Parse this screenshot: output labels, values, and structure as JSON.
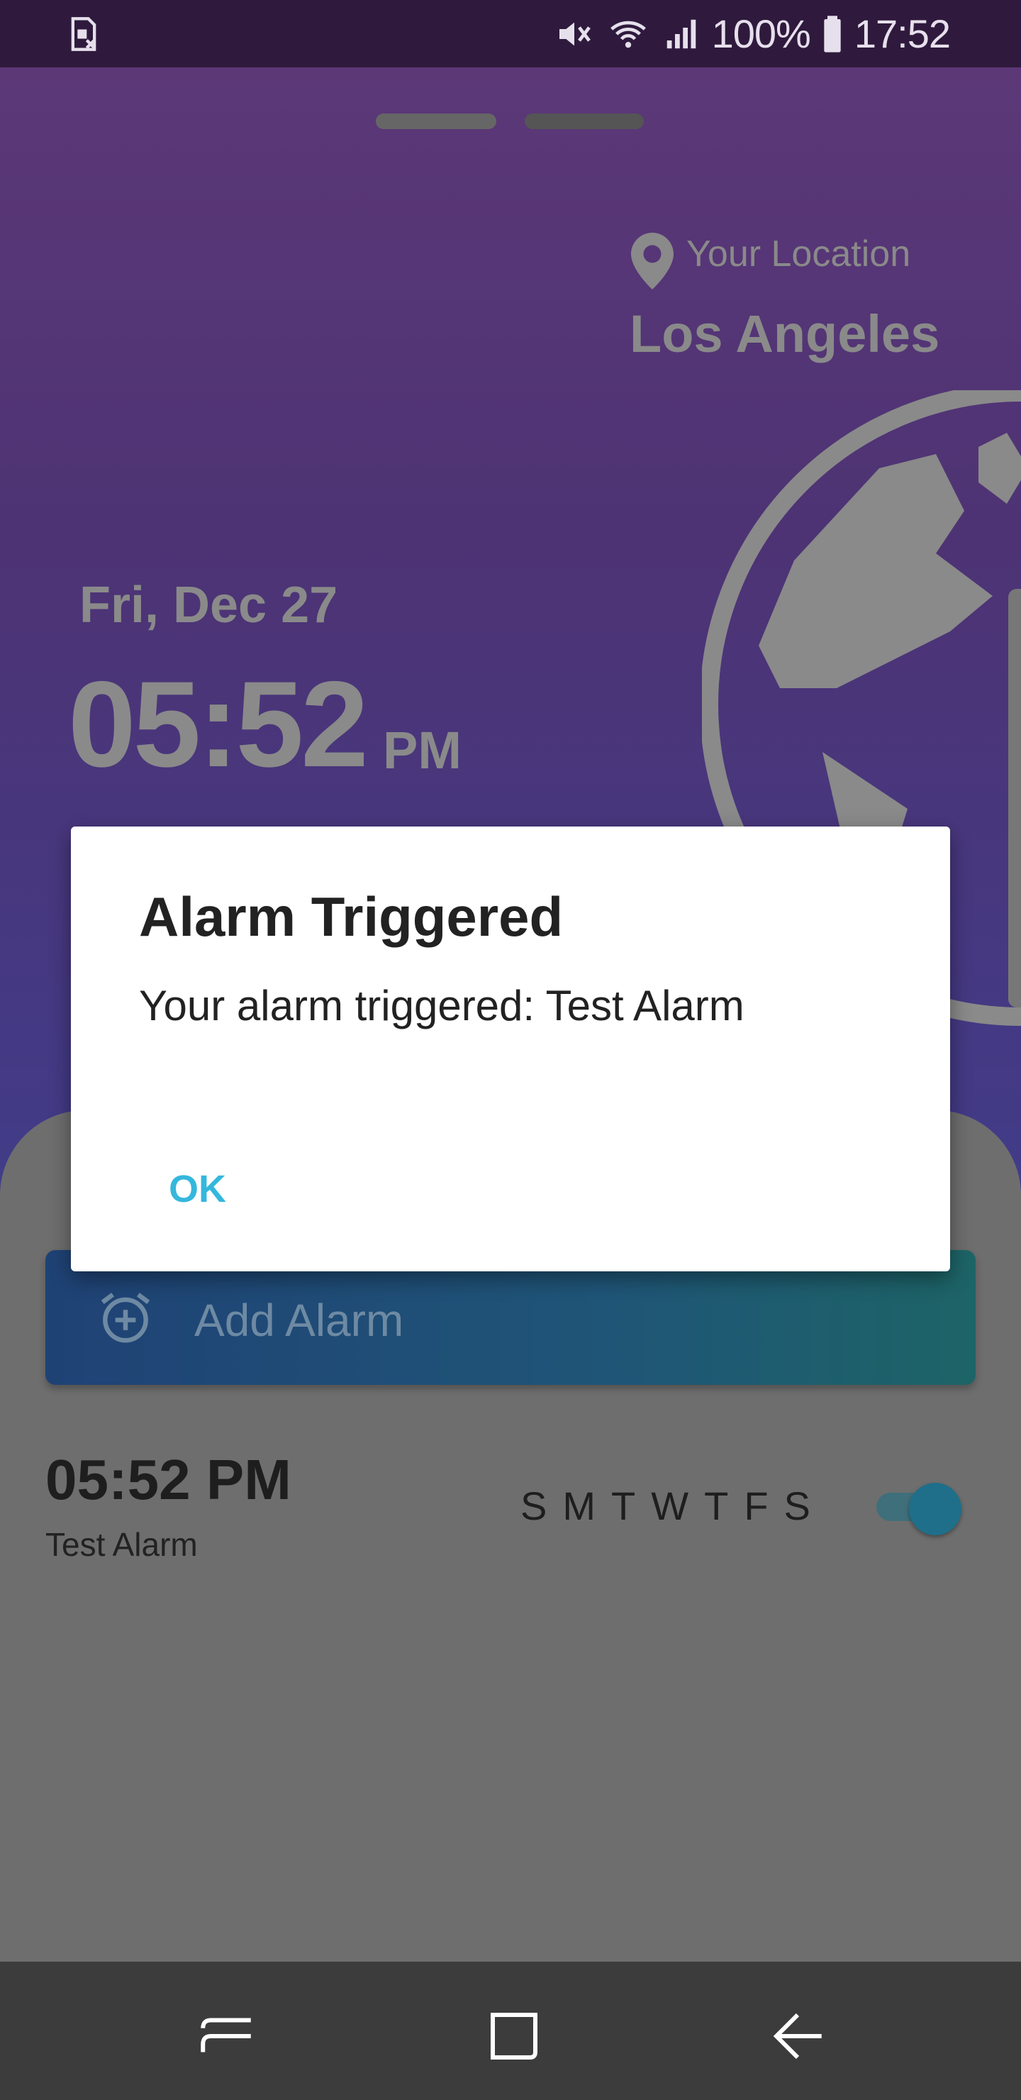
{
  "status_bar": {
    "battery_percent": "100%",
    "time": "17:52",
    "icons": [
      "sim-card-icon",
      "mute-icon",
      "wifi-icon",
      "signal-icon",
      "battery-icon"
    ]
  },
  "location": {
    "label": "Your Location",
    "city": "Los Angeles"
  },
  "clock": {
    "date": "Fri, Dec 27",
    "time": "05:52",
    "ampm": "PM"
  },
  "add_alarm": {
    "label": "Add Alarm"
  },
  "alarm": {
    "time": "05:52 PM",
    "name": "Test Alarm",
    "days": [
      "S",
      "M",
      "T",
      "W",
      "T",
      "F",
      "S"
    ],
    "enabled": true
  },
  "dialog": {
    "title": "Alarm Triggered",
    "message": "Your alarm triggered: Test Alarm",
    "ok_label": "OK"
  },
  "colors": {
    "accent": "#35b7dd",
    "status_bar": "#2f1a3d",
    "nav_bar": "#3c3c3c"
  }
}
